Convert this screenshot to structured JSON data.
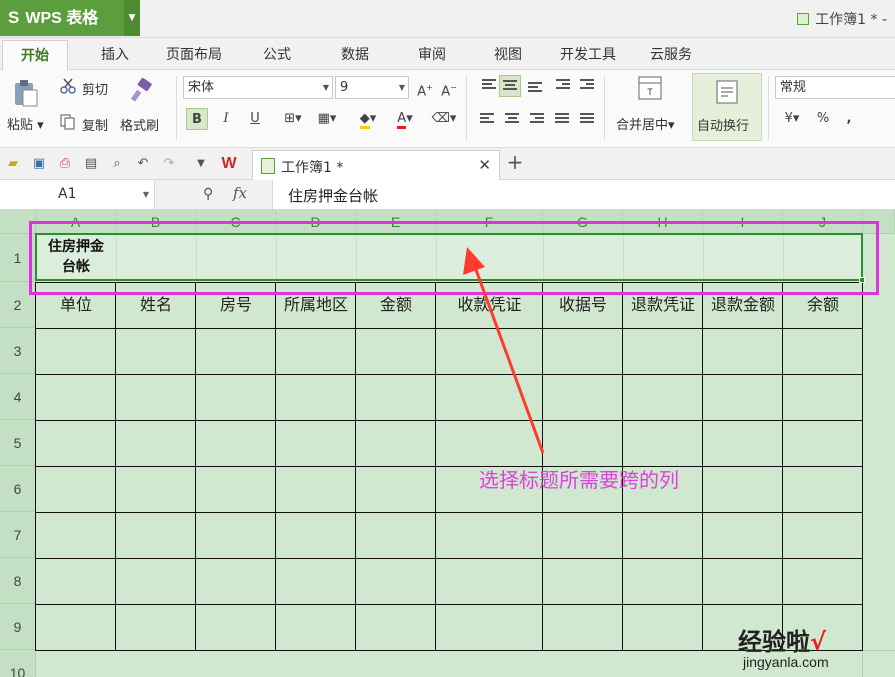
{
  "app": {
    "name": "WPS 表格",
    "title": "工作簿1 * -"
  },
  "menu_tabs": [
    "开始",
    "插入",
    "页面布局",
    "公式",
    "数据",
    "审阅",
    "视图",
    "开发工具",
    "云服务"
  ],
  "ribbon": {
    "paste": "粘贴",
    "cut": "剪切",
    "copy": "复制",
    "format_painter": "格式刷",
    "font_name": "宋体",
    "font_size": "9",
    "merge_center": "合并居中",
    "wrap_text": "自动换行",
    "number_format": "常规",
    "percent": "%"
  },
  "document_tab": {
    "name": "工作簿1 *"
  },
  "formula_bar": {
    "cell_ref": "A1",
    "fx": "fx",
    "content": "住房押金台帐"
  },
  "sheet": {
    "columns": [
      "A",
      "B",
      "C",
      "D",
      "E",
      "F",
      "G",
      "H",
      "I",
      "J"
    ],
    "rows": [
      "1",
      "2",
      "3",
      "4",
      "5",
      "6",
      "7",
      "8",
      "9",
      "10"
    ],
    "a1_line1": "住房押金",
    "a1_line2": "台帐",
    "headers": [
      "单位",
      "姓名",
      "房号",
      "所属地区",
      "金额",
      "收款凭证",
      "收据号",
      "退款凭证",
      "退款金额",
      "余额"
    ]
  },
  "annotation": {
    "text": "选择标题所需要跨的列",
    "color": "#e040e0"
  },
  "watermark": {
    "main": "经验啦",
    "check": "√",
    "sub": "jingyanla.com"
  },
  "colors": {
    "brand": "#5c9e3e",
    "sheet_bg": "#cfe8cf",
    "selection": "#2e8b2e",
    "highlight_box": "#e030e0"
  }
}
